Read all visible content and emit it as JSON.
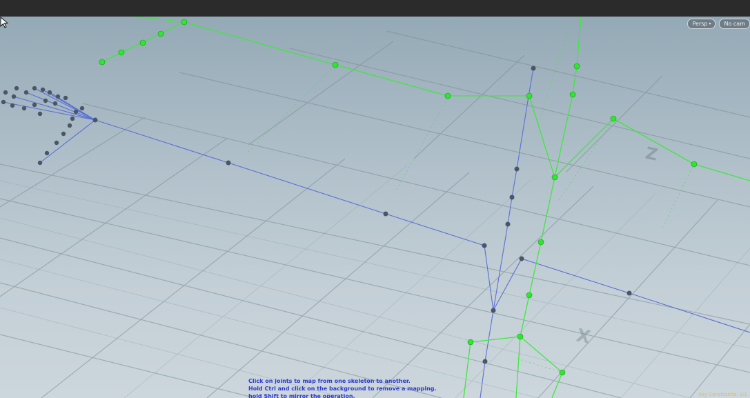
{
  "viewport": {
    "camera_menu_label": "Persp",
    "camera_menu_caret": "▾",
    "cam_button_label": "No cam"
  },
  "instructions": {
    "line1": "Click on joints to map from one skeleton to another.",
    "line2": "Hold Ctrl and click on the background to remove a mapping.",
    "line3": "hold Shift to mirror the operation."
  },
  "floor_labels": {
    "z_axis": "Z",
    "x_axis": "X"
  },
  "colors": {
    "green_skeleton": "#3ee83e",
    "blue_skeleton": "#5a6fd8",
    "instruction_text": "#2c3ad0"
  },
  "icons": {
    "cursor": "arrow-cursor-icon"
  },
  "corner_status": "Key Constraints: 1/1"
}
